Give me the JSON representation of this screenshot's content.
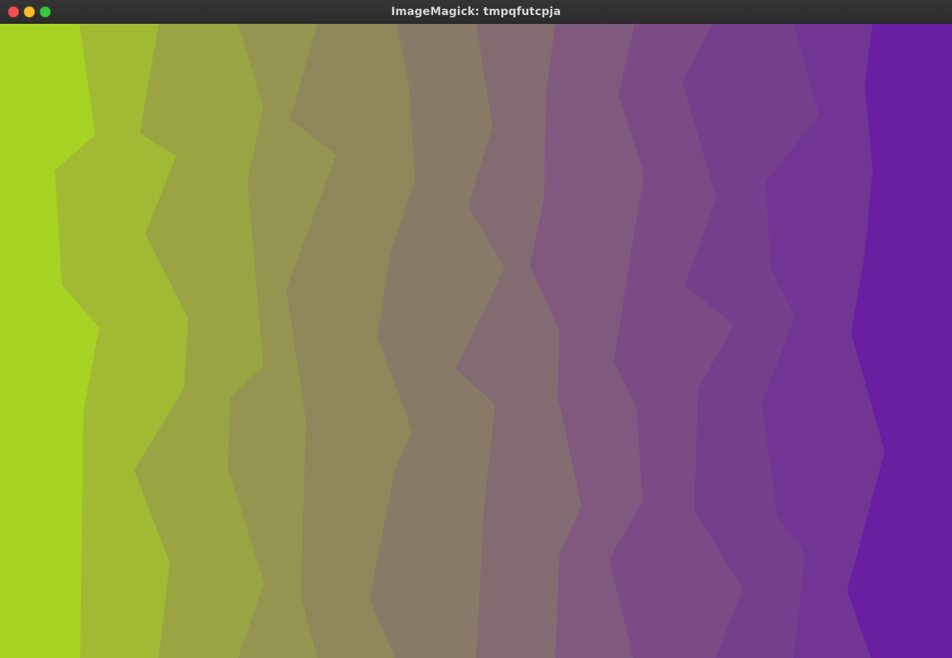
{
  "window": {
    "title": "ImageMagick: tmpqfutcpja"
  },
  "image": {
    "description_colors": {
      "start": "#abe020",
      "end": "#6a1ea2"
    }
  }
}
